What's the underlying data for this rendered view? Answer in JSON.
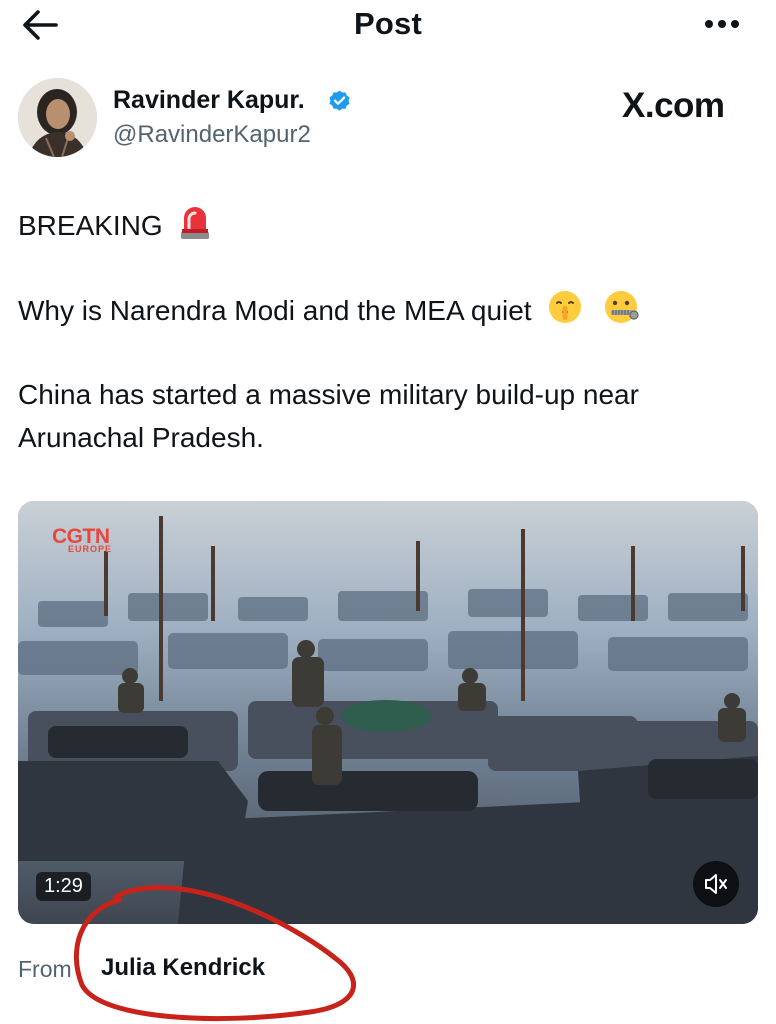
{
  "nav": {
    "title": "Post",
    "back_icon": "arrow-left-icon",
    "more_icon": "more-horizontal-icon"
  },
  "author": {
    "display_name": "Ravinder Kapur.",
    "handle": "@RavinderKapur2",
    "verified": true,
    "verified_color": "#1d9bf0"
  },
  "watermark": "X.com",
  "post": {
    "lines": [
      "BREAKING",
      "Why is Narendra Modi and the MEA quiet",
      "China has started a massive military build-up near",
      "Arunachal Pradesh."
    ],
    "emojis": [
      "rotating-light-icon",
      "shushing-face-icon",
      "zipper-mouth-face-icon"
    ]
  },
  "media": {
    "type": "video",
    "logo": "CGTN",
    "logo_sub": "EUROPE",
    "duration": "1:29",
    "mute_icon": "speaker-muted-icon"
  },
  "attribution": {
    "prefix": "From",
    "source": "Julia Kendrick"
  },
  "annotation_color": "#c8231b"
}
